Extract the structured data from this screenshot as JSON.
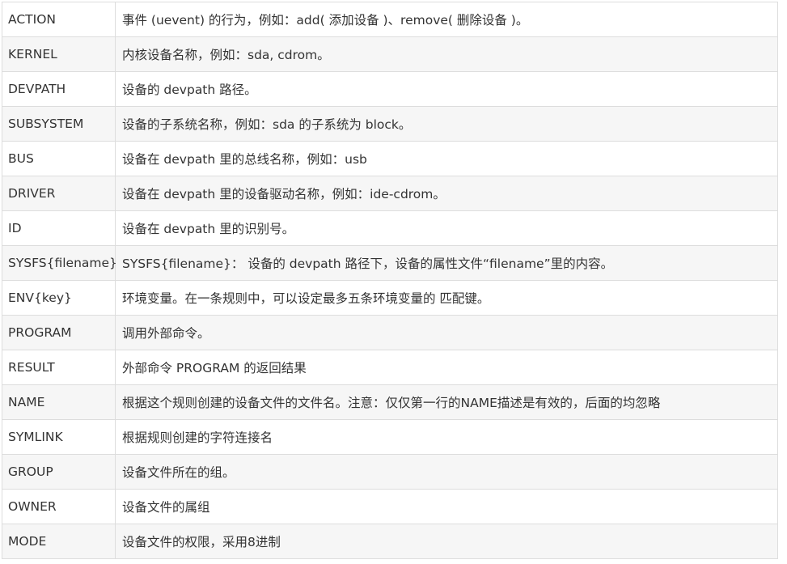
{
  "table": {
    "rows": [
      {
        "key": "ACTION",
        "desc": "事件 (uevent) 的行为，例如：add( 添加设备 )、remove( 删除设备 )。"
      },
      {
        "key": "KERNEL",
        "desc": "内核设备名称，例如：sda, cdrom。"
      },
      {
        "key": "DEVPATH",
        "desc": "设备的 devpath 路径。"
      },
      {
        "key": "SUBSYSTEM",
        "desc": "设备的子系统名称，例如：sda 的子系统为 block。"
      },
      {
        "key": "BUS",
        "desc": "设备在 devpath 里的总线名称，例如：usb"
      },
      {
        "key": "DRIVER",
        "desc": "设备在 devpath 里的设备驱动名称，例如：ide-cdrom。"
      },
      {
        "key": "ID",
        "desc": "设备在 devpath 里的识别号。"
      },
      {
        "key": "SYSFS{filename}",
        "desc": "SYSFS{filename}： 设备的 devpath 路径下，设备的属性文件“filename”里的内容。"
      },
      {
        "key": "ENV{key}",
        "desc": "环境变量。在一条规则中，可以设定最多五条环境变量的 匹配键。"
      },
      {
        "key": "PROGRAM",
        "desc": "调用外部命令。"
      },
      {
        "key": "RESULT",
        "desc": "外部命令 PROGRAM 的返回结果"
      },
      {
        "key": "NAME",
        "desc": "根据这个规则创建的设备文件的文件名。注意：仅仅第一行的NAME描述是有效的，后面的均忽略"
      },
      {
        "key": "SYMLINK",
        "desc": "根据规则创建的字符连接名"
      },
      {
        "key": "GROUP",
        "desc": "设备文件所在的组。"
      },
      {
        "key": "OWNER",
        "desc": "设备文件的属组"
      },
      {
        "key": "MODE",
        "desc": "设备文件的权限，采用8进制"
      }
    ]
  }
}
